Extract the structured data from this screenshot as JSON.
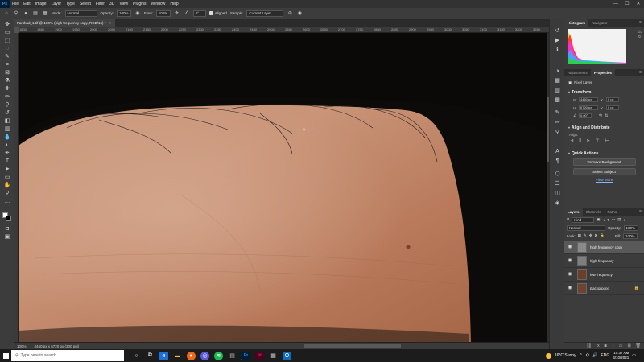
{
  "app": {
    "logo": "Ps"
  },
  "menu": [
    "File",
    "Edit",
    "Image",
    "Layer",
    "Type",
    "Select",
    "Filter",
    "3D",
    "View",
    "Plugins",
    "Window",
    "Help"
  ],
  "window_controls": {
    "minimize": "—",
    "maximize": "☐",
    "close": "✕"
  },
  "options": {
    "mode_label": "Mode:",
    "mode_value": "Normal",
    "opacity_label": "Opacity:",
    "opacity_value": "100%",
    "flow_label": "Flow:",
    "flow_value": "100%",
    "angle_value": "0°",
    "aligned_label": "Aligned",
    "sample_label": "Sample:",
    "sample_value": "Current Layer"
  },
  "document_tab": {
    "title": "Farshad_1.tif @ 100% (high frequency copy, RGB/16) *",
    "close": "×"
  },
  "ruler_ticks": [
    "1800",
    "1850",
    "1900",
    "1950",
    "2000",
    "2050",
    "2100",
    "2150",
    "2200",
    "2250",
    "2300",
    "2350",
    "2400",
    "2450",
    "2500",
    "2550",
    "2600",
    "2650",
    "2700",
    "2750",
    "2800",
    "2850",
    "2900",
    "2950",
    "3000",
    "3050",
    "3100",
    "3150",
    "3200",
    "3250",
    "3300"
  ],
  "status": {
    "zoom": "100%",
    "dimensions": "4460 px x 6720 px (300 ppi)"
  },
  "panels": {
    "histogram_tabs": [
      "Histogram",
      "Navigator"
    ],
    "props_tabs": [
      "Adjustments",
      "Properties"
    ],
    "pixel_layer": "Pixel Layer",
    "transform": {
      "title": "Transform",
      "w_label": "W",
      "w_value": "4460 px",
      "h_label": "H",
      "h_value": "6720 px",
      "x_label": "X",
      "x_value": "0 px",
      "y_label": "Y",
      "y_value": "0 px",
      "angle_value": "0.00°"
    },
    "align": {
      "title": "Align and Distribute",
      "align_label": "Align:"
    },
    "quick_actions": {
      "title": "Quick Actions",
      "remove_bg": "Remove Background",
      "select_subject": "Select Subject",
      "view_more": "View More"
    },
    "layers": {
      "tabs": [
        "Layers",
        "Channels",
        "Paths"
      ],
      "filter_value": "Kind",
      "blend_value": "Normal",
      "opacity_label": "Opacity:",
      "opacity_value": "100%",
      "lock_label": "Lock:",
      "fill_label": "Fill:",
      "fill_value": "100%",
      "items": [
        {
          "name": "high frequency copy",
          "thumb": "#8a8a8a",
          "selected": true,
          "italic": false
        },
        {
          "name": "high frequency",
          "thumb": "#7f7f7f",
          "selected": false,
          "italic": true
        },
        {
          "name": "low frequency",
          "thumb": "#6b3f2a",
          "selected": false,
          "italic": false
        },
        {
          "name": "Background",
          "thumb": "#6e4330",
          "selected": false,
          "italic": true
        }
      ]
    }
  },
  "taskbar": {
    "search_placeholder": "Type here to search",
    "weather": "16°C  Sunny",
    "lang": "ENG",
    "time": "10:37 AM",
    "date": "3/10/2021"
  }
}
